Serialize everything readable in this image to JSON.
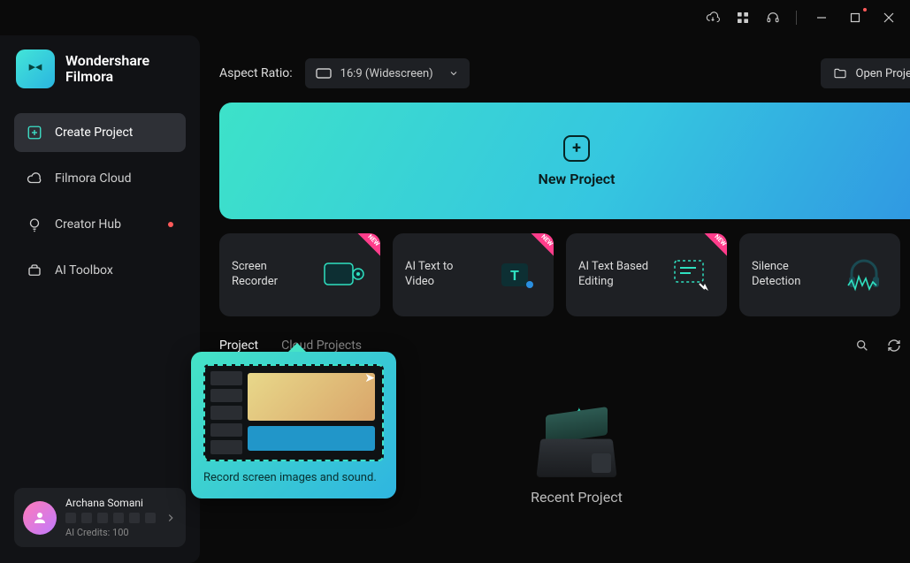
{
  "brand": {
    "line1": "Wondershare",
    "line2": "Filmora"
  },
  "nav": {
    "create": "Create Project",
    "cloud": "Filmora Cloud",
    "creator": "Creator Hub",
    "toolbox": "AI Toolbox"
  },
  "user": {
    "name": "Archana Somani",
    "credits": "AI Credits: 100"
  },
  "topbar": {
    "aspect_label": "Aspect Ratio:",
    "aspect_value": "16:9 (Widescreen)",
    "open_project": "Open Project"
  },
  "new_project_label": "New Project",
  "cards": {
    "screen_recorder": "Screen Recorder",
    "ai_text_to_video": "AI Text to Video",
    "ai_text_editing": "AI Text Based Editing",
    "silence_detection": "Silence Detection"
  },
  "recent": {
    "tab_project": "Project",
    "tab_cloud": "Cloud Projects",
    "empty_label": "Recent Project"
  },
  "tooltip": {
    "text": "Record screen images and sound."
  }
}
